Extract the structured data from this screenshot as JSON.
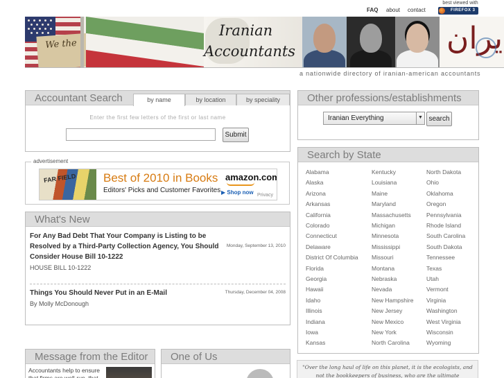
{
  "nav": {
    "faq": "FAQ",
    "about": "about",
    "contact": "contact"
  },
  "firefox": {
    "best_viewed": "best viewed with",
    "badge": "FIREFOX 3"
  },
  "banner": {
    "brand_line1": "Iranian",
    "brand_line2": "Accountants",
    "calligraphy": "ايران"
  },
  "tagline": "a nationwide directory of iranian-american accountants",
  "accountant_search": {
    "title": "Accountant Search",
    "tabs": [
      "by name",
      "by location",
      "by speciality"
    ],
    "hint": "Enter the first few letters of the first or last name",
    "input_value": "",
    "submit": "Submit"
  },
  "advertisement": {
    "legend": "advertisement",
    "headline": "Best of 2010 in Books",
    "subline": "Editors' Picks and Customer Favorites",
    "brand": "amazon.com",
    "cta": "Shop now",
    "privacy": "Privacy",
    "cover_text": "FAR FIELD"
  },
  "whats_new": {
    "title": "What's New",
    "items": [
      {
        "title": "For Any Bad Debt That Your Company is Listing to be Resolved by a Third-Party Collection Agency, You Should Consider House Bill 10-1222",
        "date": "Monday, September 13, 2010",
        "sub": "HOUSE BILL 10-1222"
      },
      {
        "title": "Things You Should Never Put in an E-Mail",
        "date": "Thursday, December 04, 2008",
        "sub": "By Molly McDonough"
      }
    ]
  },
  "other_professions": {
    "title": "Other professions/establishments",
    "selected": "Iranian Everything",
    "search": "search"
  },
  "search_by_state": {
    "title": "Search by State",
    "columns": [
      [
        "Alabama",
        "Alaska",
        "Arizona",
        "Arkansas",
        "California",
        "Colorado",
        "Connecticut",
        "Delaware",
        "District Of Columbia",
        "Florida",
        "Georgia",
        "Hawaii",
        "Idaho",
        "Illinois",
        "Indiana",
        "Iowa",
        "Kansas"
      ],
      [
        "Kentucky",
        "Louisiana",
        "Maine",
        "Maryland",
        "Massachusetts",
        "Michigan",
        "Minnesota",
        "Mississippi",
        "Missouri",
        "Montana",
        "Nebraska",
        "Nevada",
        "New Hampshire",
        "New Jersey",
        "New Mexico",
        "New York",
        "North Carolina"
      ],
      [
        "North Dakota",
        "Ohio",
        "Oklahoma",
        "Oregon",
        "Pennsylvania",
        "Rhode Island",
        "South Carolina",
        "South Dakota",
        "Tennessee",
        "Texas",
        "Utah",
        "Vermont",
        "Virginia",
        "Washington",
        "West Virginia",
        "Wisconsin",
        "Wyoming"
      ]
    ]
  },
  "editor": {
    "title": "Message from the Editor",
    "text": "Accountants help to ensure that firms are well-run, that"
  },
  "one_of_us": {
    "title": "One of Us"
  },
  "quote": "\"Over the long haul of life on this planet, it is the ecologists, and not the bookkeepers of business, who are the ultimate accountants.\"",
  "colors": {
    "panel_header": "#dddddd",
    "panel_border": "#bdbdbd",
    "ad_orange": "#d77b12"
  }
}
